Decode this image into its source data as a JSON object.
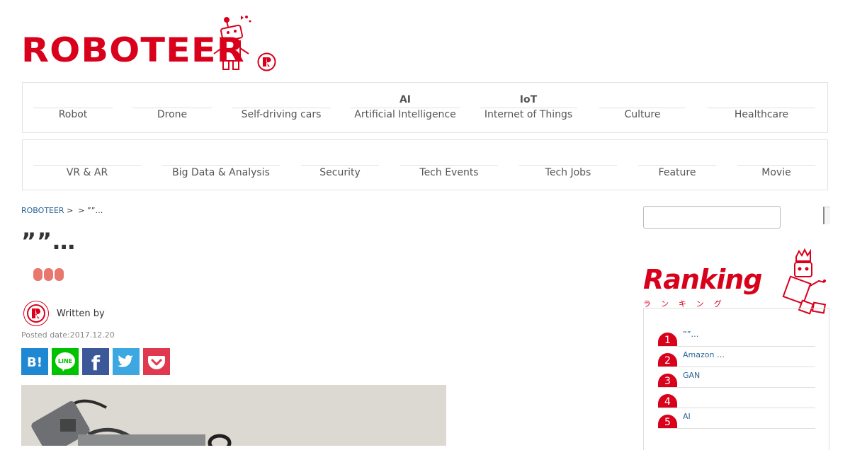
{
  "brand": {
    "logo_text": "ROBOTEER",
    "accent_color": "#d9001b"
  },
  "nav_row1": [
    {
      "top": "",
      "label": "Robot"
    },
    {
      "top": "",
      "label": "Drone"
    },
    {
      "top": "",
      "label": "Self-driving cars"
    },
    {
      "top": "AI",
      "label": "Artificial Intelligence"
    },
    {
      "top": "IoT",
      "label": "Internet of Things"
    },
    {
      "top": "",
      "label": "Culture"
    },
    {
      "top": "",
      "label": "Healthcare"
    }
  ],
  "nav_row2": [
    {
      "label": "VR & AR"
    },
    {
      "label": "Big Data & Analysis"
    },
    {
      "label": "Security"
    },
    {
      "label": "Tech Events"
    },
    {
      "label": "Tech Jobs"
    },
    {
      "label": "Feature"
    },
    {
      "label": "Movie"
    }
  ],
  "breadcrumb": {
    "home": "ROBOTEER",
    "sep1": ">",
    "sep2": ">",
    "current": "””…"
  },
  "article": {
    "title": "””…",
    "author_label": "Written by",
    "posted": "Posted date:2017.12.20"
  },
  "share": {
    "icons": [
      "hatena-bookmark-icon",
      "line-icon",
      "facebook-icon",
      "twitter-icon",
      "pocket-icon"
    ],
    "colors": {
      "hatena": "#1e88d2",
      "line": "#00c300",
      "facebook": "#3b5998",
      "twitter": "#3ca7e0",
      "pocket": "#e0384e"
    },
    "hatena_text": "B!",
    "line_text": "LINE",
    "facebook_text": "f"
  },
  "sidebar": {
    "search_placeholder": "",
    "ranking_title": "Ranking",
    "ranking_sub": "ランキング",
    "items": [
      {
        "rank": "1",
        "text": "””…"
      },
      {
        "rank": "2",
        "text": "Amazon …"
      },
      {
        "rank": "3",
        "text": "GAN"
      },
      {
        "rank": "4",
        "text": ""
      },
      {
        "rank": "5",
        "text": "AI"
      }
    ]
  }
}
